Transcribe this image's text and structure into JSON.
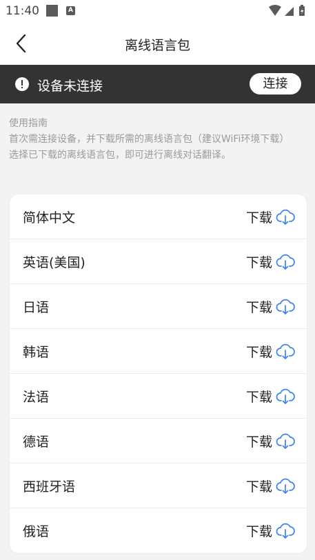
{
  "status_bar": {
    "time": "11:40",
    "a_badge": "A"
  },
  "header": {
    "title": "离线语言包"
  },
  "banner": {
    "text": "设备未连接",
    "connect_label": "连接"
  },
  "guide": {
    "heading": "使用指南",
    "line1": "首次需连接设备，并下载所需的离线语言包（建议WiFi环境下载）",
    "line2": "选择已下载的离线语言包，即可进行离线对话翻译。"
  },
  "languages": [
    {
      "name": "简体中文",
      "action": "下载"
    },
    {
      "name": "英语(美国)",
      "action": "下载"
    },
    {
      "name": "日语",
      "action": "下载"
    },
    {
      "name": "韩语",
      "action": "下载"
    },
    {
      "name": "法语",
      "action": "下载"
    },
    {
      "name": "德语",
      "action": "下载"
    },
    {
      "name": "西班牙语",
      "action": "下载"
    },
    {
      "name": "俄语",
      "action": "下载"
    }
  ],
  "colors": {
    "banner_bg": "#333333",
    "icon_blue": "#3b82f6",
    "page_bg": "#f3f3f3"
  },
  "icons": {
    "back": "chevron-left-icon",
    "alert": "alert-icon",
    "download": "cloud-download-icon"
  }
}
